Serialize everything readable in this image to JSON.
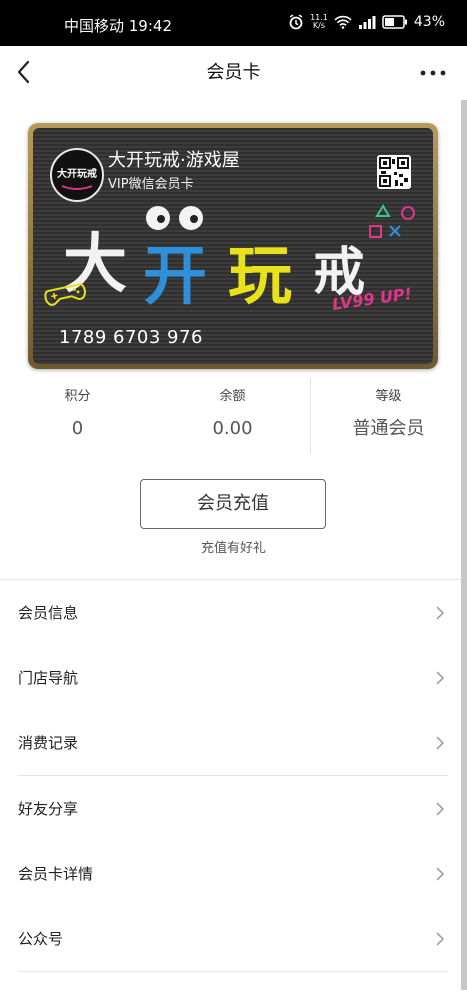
{
  "status": {
    "carrier_time": "中国移动 19:42",
    "speed_value": "11.1",
    "speed_unit": "K/s",
    "battery": "43%"
  },
  "nav": {
    "title": "会员卡"
  },
  "card": {
    "name": "大开玩戒·游戏屋",
    "subtitle": "VIP微信会员卡",
    "number": "1789 6703 976",
    "art_text": "大开玩戒",
    "logo_text": "大开玩戒",
    "tagline": "LV99 UP!"
  },
  "stats": [
    {
      "label": "积分",
      "value": "0"
    },
    {
      "label": "余额",
      "value": "0.00"
    },
    {
      "label": "等级",
      "value": "普通会员"
    }
  ],
  "recharge": {
    "button": "会员充值",
    "tip": "充值有好礼"
  },
  "menu": [
    {
      "label": "会员信息"
    },
    {
      "label": "门店导航"
    },
    {
      "label": "消费记录"
    },
    {
      "label": "好友分享"
    },
    {
      "label": "会员卡详情"
    },
    {
      "label": "公众号"
    }
  ],
  "colors": {
    "art_white": "#f2f2f2",
    "art_blue": "#2f8fd8",
    "art_yellow": "#e8e21a",
    "tagline_pink": "#e0378a"
  }
}
